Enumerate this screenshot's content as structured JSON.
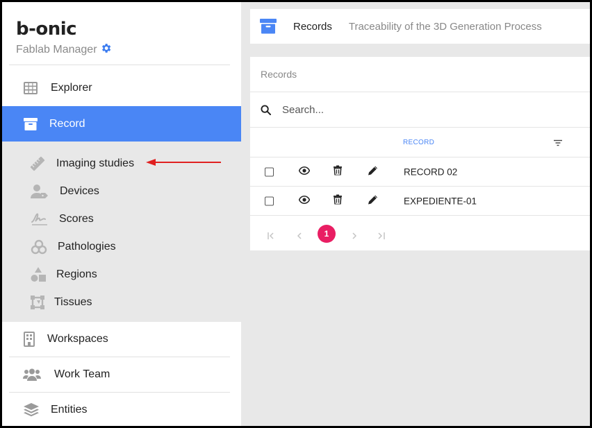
{
  "brand": {
    "logo": "b-onic",
    "subtitle": "Fablab Manager"
  },
  "sidebar": {
    "explorer": "Explorer",
    "record": "Record",
    "submenu": [
      {
        "label": "Imaging studies",
        "icon": "ruler-icon"
      },
      {
        "label": "Devices",
        "icon": "user-tag-icon"
      },
      {
        "label": "Scores",
        "icon": "signature-icon"
      },
      {
        "label": "Pathologies",
        "icon": "biohazard-icon"
      },
      {
        "label": "Regions",
        "icon": "shapes-icon"
      },
      {
        "label": "Tissues",
        "icon": "vector-square-icon"
      }
    ],
    "workspaces": "Workspaces",
    "work_team": "Work Team",
    "entities": "Entities"
  },
  "topbar": {
    "title": "Records",
    "subtitle": "Traceability of the 3D Generation Process"
  },
  "card": {
    "header": "Records",
    "search_placeholder": "Search...",
    "column_record": "RECORD",
    "rows": [
      {
        "record": "RECORD 02"
      },
      {
        "record": "EXPEDIENTE-01"
      }
    ],
    "current_page": "1"
  },
  "colors": {
    "accent": "#4a86f5",
    "page_active": "#e91e63",
    "arrow": "#e02020"
  }
}
